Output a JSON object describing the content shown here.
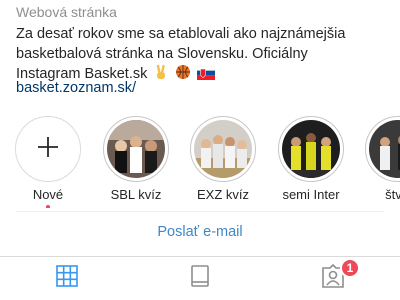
{
  "profile": {
    "category": "Webová stránka",
    "bio_lines": [
      "Za desať rokov sme sa etablovali ako najznámejšia",
      "basketbalová stránka na Slovensku. Oficiálny",
      "Instagram Basket.sk"
    ],
    "link": "basket.zoznam.sk/"
  },
  "highlights": [
    {
      "label": "Nové",
      "icon": "plus-icon"
    },
    {
      "label": "SBL kvíz",
      "icon": "highlight-cover"
    },
    {
      "label": "EXZ kvíz",
      "icon": "highlight-cover"
    },
    {
      "label": "semi Inter",
      "icon": "highlight-cover"
    },
    {
      "label": "štvrť",
      "icon": "highlight-cover"
    }
  ],
  "actions": {
    "email_label": "Poslať e-mail"
  },
  "tabs": [
    {
      "name": "grid-tab",
      "icon": "grid-icon",
      "active": true
    },
    {
      "name": "igtv-tab",
      "icon": "tv-icon",
      "active": false
    },
    {
      "name": "tagged-tab",
      "icon": "tagged-user-icon",
      "active": false
    }
  ],
  "notifications": {
    "tagged_badge": "1"
  },
  "colors": {
    "accent": "#3897f0",
    "link": "#00376b",
    "badge": "#ed4956"
  }
}
